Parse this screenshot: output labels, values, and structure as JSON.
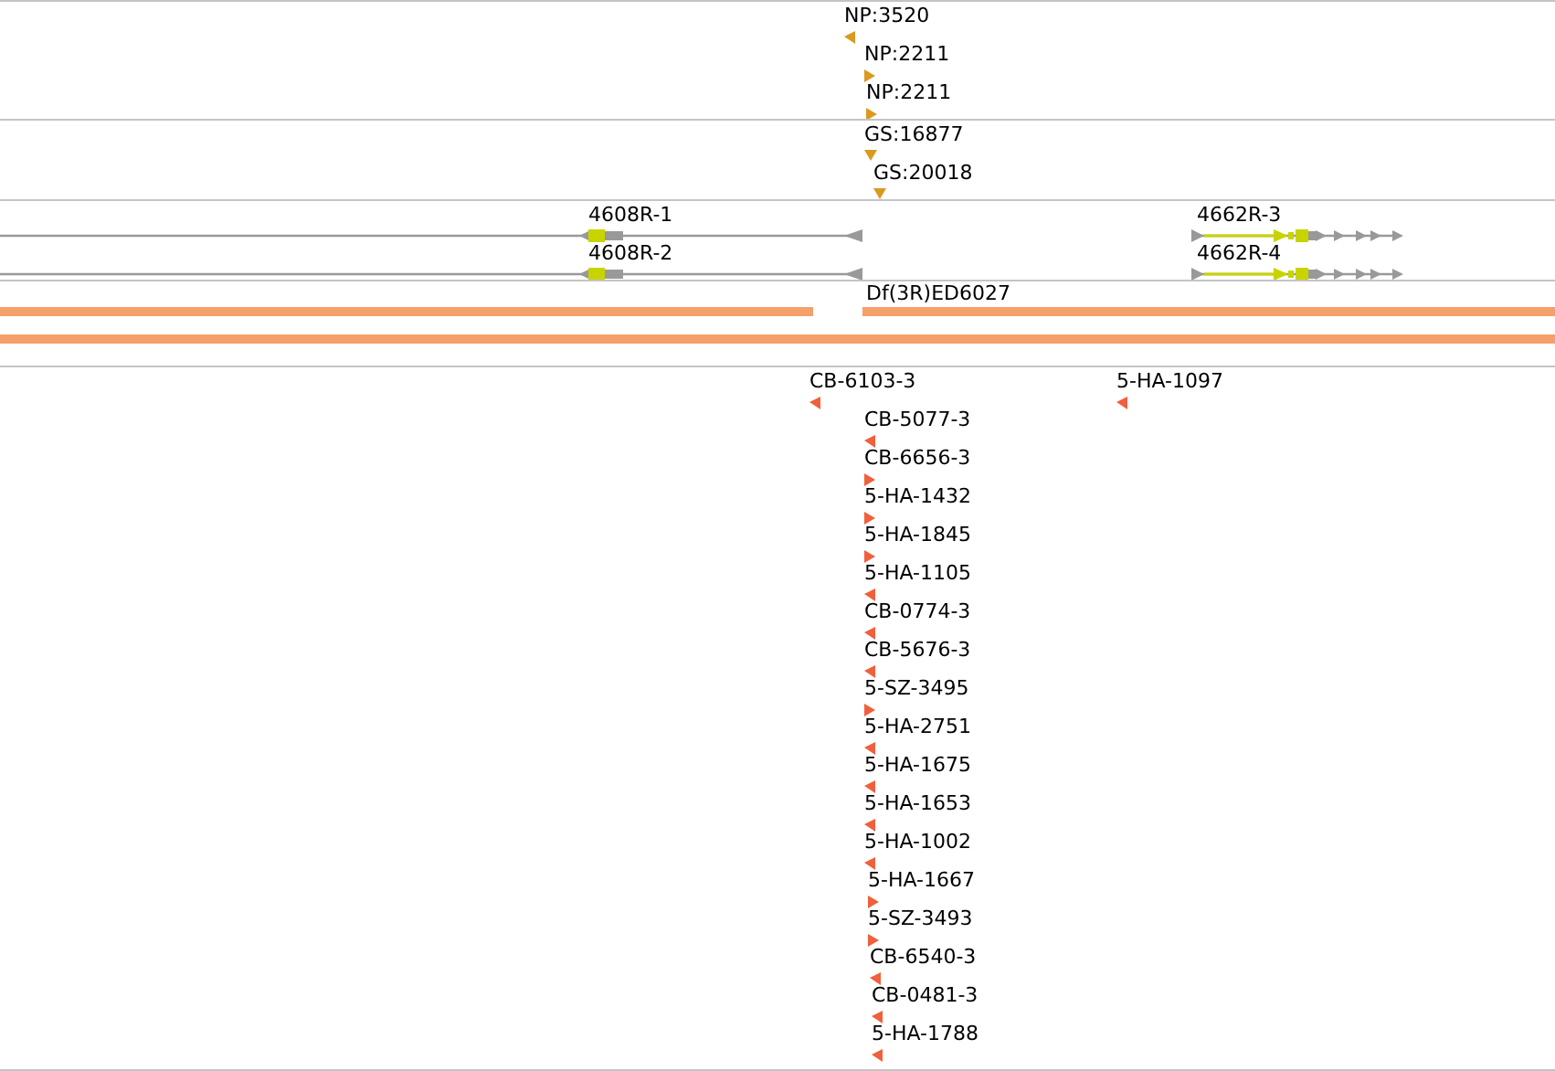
{
  "tracks": [
    {
      "kind": "insertions",
      "color": "#d99a1e",
      "rows": [
        {
          "features": [
            {
              "label": "NP:3520",
              "kind": "left"
            }
          ]
        },
        {
          "features": [
            {
              "label": "NP:2211",
              "kind": "right"
            }
          ]
        },
        {
          "features": [
            {
              "label": "NP:2211",
              "kind": "right"
            }
          ]
        }
      ]
    },
    {
      "kind": "insertions",
      "color": "#d99a1e",
      "rows": [
        {
          "features": [
            {
              "label": "GS:16877",
              "kind": "down"
            }
          ]
        },
        {
          "features": [
            {
              "label": "GS:20018",
              "kind": "down"
            }
          ]
        }
      ]
    },
    {
      "kind": "transcripts",
      "rows": [
        {
          "features": [
            {
              "label": "4608R-1",
              "kind": "minus"
            },
            {
              "label": "4662R-3",
              "kind": "plus"
            }
          ]
        },
        {
          "features": [
            {
              "label": "4608R-2",
              "kind": "minus"
            },
            {
              "label": "4662R-4",
              "kind": "plus"
            }
          ]
        }
      ]
    },
    {
      "kind": "deficiency",
      "label": "Df(3R)ED6027"
    },
    {
      "kind": "insertions",
      "color": "#f0603c",
      "rows": [
        {
          "features": [
            {
              "label": "CB-6103-3",
              "kind": "left"
            },
            {
              "label": "5-HA-1097",
              "kind": "left"
            }
          ]
        },
        {
          "features": [
            {
              "label": "CB-5077-3",
              "kind": "left"
            }
          ]
        },
        {
          "features": [
            {
              "label": "CB-6656-3",
              "kind": "right"
            }
          ]
        },
        {
          "features": [
            {
              "label": "5-HA-1432",
              "kind": "right"
            }
          ]
        },
        {
          "features": [
            {
              "label": "5-HA-1845",
              "kind": "right"
            }
          ]
        },
        {
          "features": [
            {
              "label": "5-HA-1105",
              "kind": "left"
            }
          ]
        },
        {
          "features": [
            {
              "label": "CB-0774-3",
              "kind": "left"
            }
          ]
        },
        {
          "features": [
            {
              "label": "CB-5676-3",
              "kind": "left"
            }
          ]
        },
        {
          "features": [
            {
              "label": "5-SZ-3495",
              "kind": "right"
            }
          ]
        },
        {
          "features": [
            {
              "label": "5-HA-2751",
              "kind": "left"
            }
          ]
        },
        {
          "features": [
            {
              "label": "5-HA-1675",
              "kind": "left"
            }
          ]
        },
        {
          "features": [
            {
              "label": "5-HA-1653",
              "kind": "left"
            }
          ]
        },
        {
          "features": [
            {
              "label": "5-HA-1002",
              "kind": "left"
            }
          ]
        },
        {
          "features": [
            {
              "label": "5-HA-1667",
              "kind": "right"
            }
          ]
        },
        {
          "features": [
            {
              "label": "5-SZ-3493",
              "kind": "right"
            }
          ]
        },
        {
          "features": [
            {
              "label": "CB-6540-3",
              "kind": "left"
            }
          ]
        },
        {
          "features": [
            {
              "label": "CB-0481-3",
              "kind": "left"
            }
          ]
        },
        {
          "features": [
            {
              "label": "5-HA-1788",
              "kind": "left"
            }
          ]
        }
      ]
    }
  ]
}
